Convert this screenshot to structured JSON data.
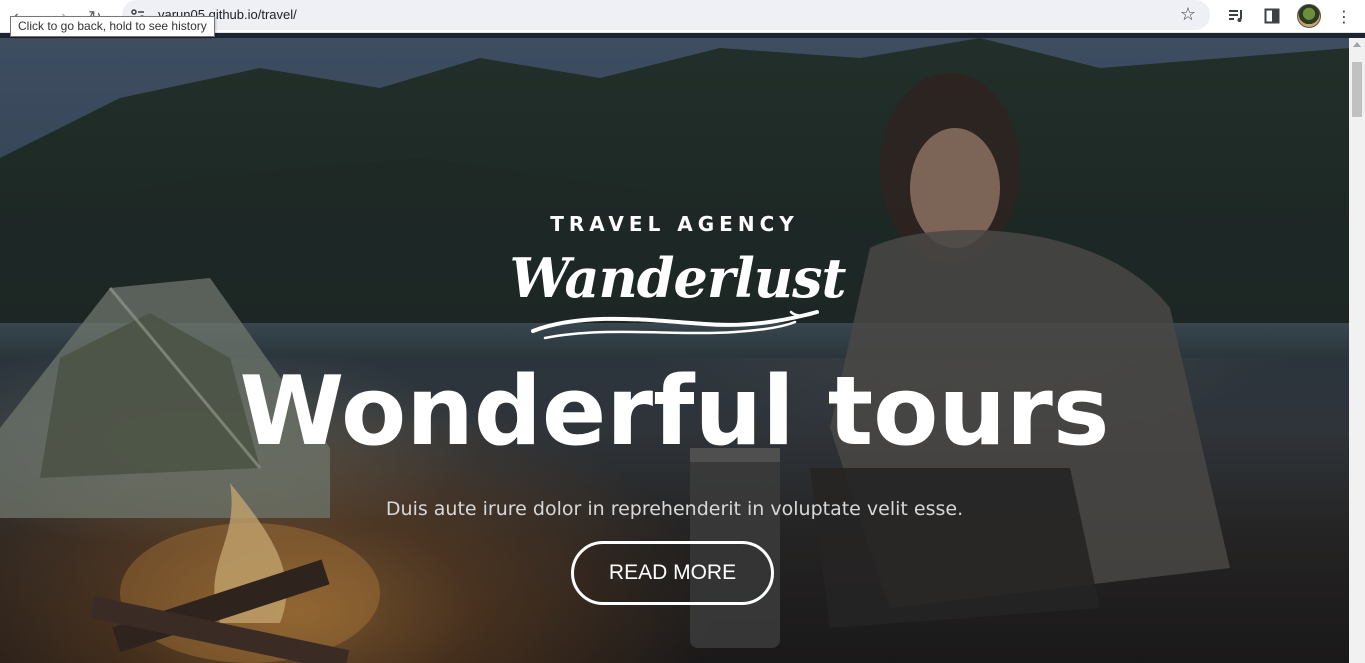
{
  "browser": {
    "url": "varun05.github.io/travel/",
    "tooltip": "Click to go back, hold to see history",
    "icons": {
      "back": "arrow-left-icon",
      "forward": "arrow-right-icon",
      "reload": "reload-icon",
      "site_info": "site-info-icon",
      "bookmark": "star-icon",
      "media": "media-control-icon",
      "side_panel": "side-panel-icon",
      "profile": "avatar",
      "menu": "kebab-menu-icon"
    }
  },
  "hero": {
    "eyebrow": "TRAVEL AGENCY",
    "logo_text": "Wanderlust",
    "headline": "Wonderful tours",
    "subtitle": "Duis aute irure dolor in reprehenderit in voluptate velit esse.",
    "cta_label": "READ MORE"
  },
  "colors": {
    "text": "#ffffff",
    "subtitle": "#d8d8d8",
    "chrome_bg": "#ffffff",
    "omnibox_bg": "#eef0f5"
  }
}
